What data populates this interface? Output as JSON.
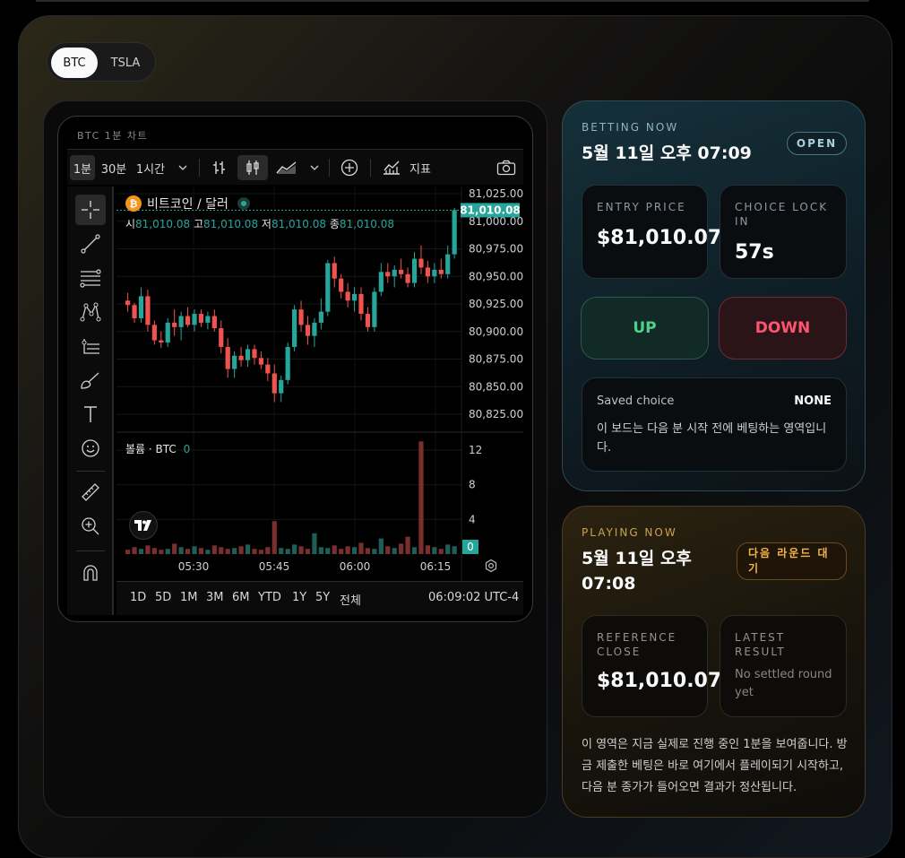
{
  "asset_toggle": {
    "options": [
      "BTC",
      "TSLA"
    ],
    "selected": "BTC"
  },
  "chart_widget": {
    "caption": "BTC 1분 차트",
    "toolbar": {
      "interval_1m": "1분",
      "interval_30m": "30분",
      "interval_1h": "1시간",
      "indicators": "지표"
    },
    "symbol_title": "비트코인 / 달러",
    "ohlc": {
      "open_label": "시",
      "open": "81,010.08",
      "high_label": "고",
      "high": "81,010.08",
      "low_label": "저",
      "low": "81,010.08",
      "close_label": "종",
      "close": "81,010.08"
    },
    "last_price_tag": "81,010.08",
    "price_axis": [
      "81,025.00",
      "81,000.00",
      "80,975.00",
      "80,950.00",
      "80,925.00",
      "80,900.00",
      "80,875.00",
      "80,850.00",
      "80,825.00"
    ],
    "volume": {
      "label": "볼륨 · BTC",
      "value": "0",
      "axis": [
        "12",
        "8",
        "4"
      ],
      "last_tag": "0"
    },
    "time_axis": [
      "05:30",
      "05:45",
      "06:00",
      "06:15"
    ],
    "ranges": [
      "1D",
      "5D",
      "1M",
      "3M",
      "6M",
      "YTD",
      "1Y",
      "5Y",
      "전체"
    ],
    "clock": "06:09:02 UTC-4",
    "colors": {
      "up": "#26a69a",
      "down": "#ef5350"
    }
  },
  "chart_data": {
    "type": "candlestick",
    "y_range": [
      80815,
      81030
    ],
    "x_ticks": [
      "05:30",
      "05:45",
      "06:00",
      "06:15"
    ],
    "candles_ohlc": [
      [
        80928,
        80935,
        80918,
        80924
      ],
      [
        80924,
        80926,
        80908,
        80912
      ],
      [
        80912,
        80940,
        80908,
        80932
      ],
      [
        80932,
        80938,
        80900,
        80906
      ],
      [
        80906,
        80910,
        80888,
        80892
      ],
      [
        80892,
        80900,
        80885,
        80890
      ],
      [
        80890,
        80912,
        80886,
        80908
      ],
      [
        80908,
        80920,
        80896,
        80904
      ],
      [
        80904,
        80918,
        80892,
        80914
      ],
      [
        80914,
        80922,
        80904,
        80906
      ],
      [
        80906,
        80920,
        80900,
        80916
      ],
      [
        80916,
        80920,
        80904,
        80908
      ],
      [
        80908,
        80918,
        80902,
        80914
      ],
      [
        80914,
        80920,
        80900,
        80903
      ],
      [
        80903,
        80910,
        80880,
        80886
      ],
      [
        80886,
        80894,
        80858,
        80866
      ],
      [
        80866,
        80882,
        80858,
        80878
      ],
      [
        80878,
        80886,
        80868,
        80874
      ],
      [
        80874,
        80888,
        80868,
        80884
      ],
      [
        80884,
        80888,
        80870,
        80876
      ],
      [
        80876,
        80882,
        80866,
        80870
      ],
      [
        80870,
        80876,
        80855,
        80862
      ],
      [
        80862,
        80870,
        80836,
        80844
      ],
      [
        80844,
        80860,
        80836,
        80856
      ],
      [
        80856,
        80890,
        80852,
        80886
      ],
      [
        80886,
        80924,
        80882,
        80920
      ],
      [
        80920,
        80928,
        80900,
        80906
      ],
      [
        80906,
        80914,
        80888,
        80896
      ],
      [
        80896,
        80912,
        80886,
        80908
      ],
      [
        80908,
        80930,
        80902,
        80918
      ],
      [
        80918,
        80965,
        80914,
        80962
      ],
      [
        80962,
        80968,
        80940,
        80948
      ],
      [
        80948,
        80952,
        80930,
        80936
      ],
      [
        80936,
        80944,
        80922,
        80928
      ],
      [
        80928,
        80940,
        80918,
        80934
      ],
      [
        80934,
        80940,
        80910,
        80916
      ],
      [
        80916,
        80922,
        80900,
        80904
      ],
      [
        80904,
        80940,
        80900,
        80936
      ],
      [
        80936,
        80962,
        80932,
        80954
      ],
      [
        80954,
        80962,
        80944,
        80950
      ],
      [
        80950,
        80960,
        80940,
        80956
      ],
      [
        80956,
        80966,
        80948,
        80952
      ],
      [
        80952,
        80958,
        80940,
        80944
      ],
      [
        80944,
        80972,
        80940,
        80966
      ],
      [
        80966,
        80978,
        80952,
        80958
      ],
      [
        80958,
        80964,
        80944,
        80950
      ],
      [
        80950,
        80962,
        80944,
        80956
      ],
      [
        80956,
        80966,
        80948,
        80952
      ],
      [
        80952,
        80978,
        80948,
        80970
      ],
      [
        80970,
        81012,
        80966,
        81010
      ]
    ],
    "volumes": [
      0.5,
      0.8,
      0.6,
      1.0,
      0.7,
      0.5,
      0.6,
      1.2,
      0.8,
      0.6,
      0.9,
      0.7,
      0.5,
      1.0,
      0.8,
      0.6,
      0.7,
      0.9,
      1.1,
      0.6,
      0.5,
      0.8,
      3.8,
      0.7,
      0.6,
      1.1,
      0.9,
      0.6,
      2.4,
      0.8,
      0.7,
      1.0,
      0.6,
      0.9,
      0.8,
      1.3,
      0.7,
      0.6,
      1.8,
      0.9,
      0.7,
      1.2,
      2.0,
      0.8,
      13.0,
      1.0,
      0.8,
      0.6,
      1.1,
      0.9
    ]
  },
  "betting": {
    "eyebrow": "BETTING NOW",
    "title": "5월 11일 오후 07:09",
    "badge": "OPEN",
    "entry": {
      "label": "ENTRY PRICE",
      "value": "$81,010.07"
    },
    "lock": {
      "label": "CHOICE LOCK IN",
      "value": "57s"
    },
    "up_label": "UP",
    "down_label": "DOWN",
    "saved": {
      "label": "Saved choice",
      "value": "NONE",
      "desc": "이 보드는 다음 분 시작 전에 베팅하는 영역입니다."
    }
  },
  "playing": {
    "eyebrow": "PLAYING NOW",
    "title": "5월 11일 오후 07:08",
    "badge": "다음 라운드 대기",
    "reference": {
      "label": "REFERENCE CLOSE",
      "value": "$81,010.07"
    },
    "latest": {
      "label": "LATEST RESULT",
      "value": "No settled round yet"
    },
    "desc": "이 영역은 지금 실제로 진행 중인 1분을 보여줍니다. 방금 제출한 베팅은 바로 여기에서 플레이되기 시작하고, 다음 분 종가가 들어오면 결과가 정산됩니다."
  }
}
